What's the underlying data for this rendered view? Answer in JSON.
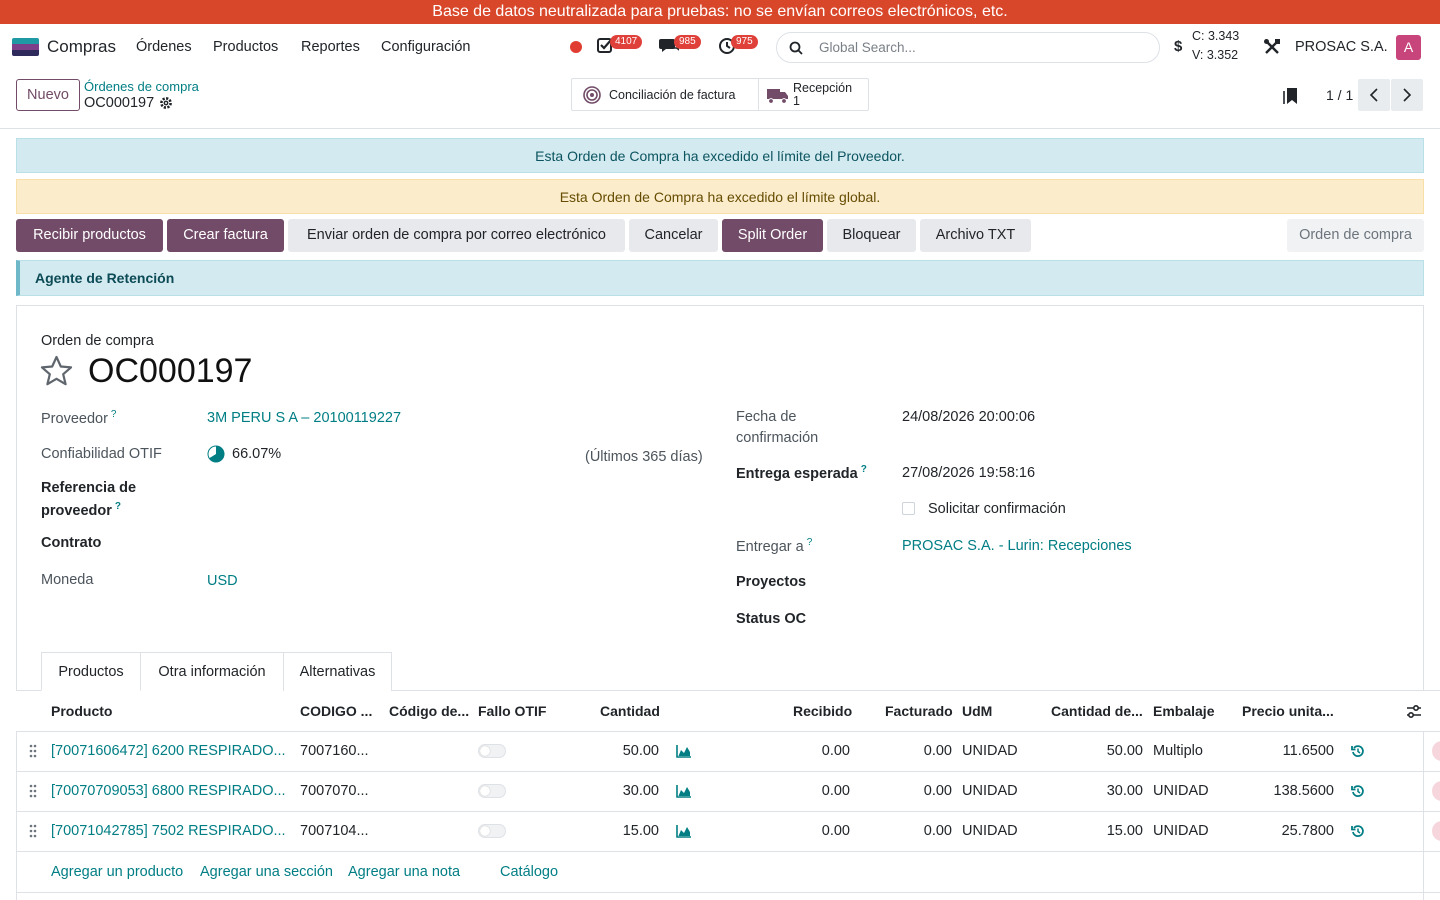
{
  "banner": {
    "text": "Base de datos neutralizada para pruebas: no se envían correos electrónicos, etc."
  },
  "navbar": {
    "app_name": "Compras",
    "menu": [
      "Órdenes",
      "Productos",
      "Reportes",
      "Configuración"
    ],
    "badges": {
      "activities": "4107",
      "messages": "985",
      "clock": "975"
    },
    "search_placeholder": "Global Search...",
    "rates": {
      "buy": "C: 3.343",
      "sell": "V: 3.352"
    },
    "company": "PROSAC S.A.",
    "avatar_letter": "A",
    "icons": [
      "status-dot-icon",
      "activity-check-icon",
      "chat-icon",
      "clock-icon",
      "search-icon",
      "dollar-icon",
      "tools-icon"
    ]
  },
  "control": {
    "new_label": "Nuevo",
    "breadcrumb_parent": "Órdenes de compra",
    "breadcrumb_current": "OC000197",
    "smart_buttons": {
      "conciliation": "Conciliación de factura",
      "reception_label": "Recepción",
      "reception_count": "1"
    },
    "pager": "1 / 1"
  },
  "alerts": {
    "vendor_limit": "Esta Orden de Compra ha excedido el límite del Proveedor.",
    "global_limit": "Esta Orden de Compra ha excedido el límite global.",
    "retention": "Agente de Retención"
  },
  "statusbar": {
    "receive": "Recibir productos",
    "invoice": "Crear factura",
    "send_email": "Enviar orden de compra por correo electrónico",
    "cancel": "Cancelar",
    "split": "Split Order",
    "lock": "Bloquear",
    "txt": "Archivo TXT",
    "state": "Orden de compra"
  },
  "form": {
    "doc_type": "Orden de compra",
    "name": "OC000197",
    "left": {
      "vendor_label": "Proveedor",
      "vendor_value": "3M PERU S A – 20100119227",
      "otif_label": "Confiabilidad OTIF",
      "otif_value": "66.07%",
      "otif_period": "(Últimos 365 días)",
      "otif_fraction": 0.6607,
      "vendor_ref_label_1": "Referencia de",
      "vendor_ref_label_2": "proveedor",
      "contract_label": "Contrato",
      "currency_label": "Moneda",
      "currency_value": "USD"
    },
    "right": {
      "confirm_label_1": "Fecha de",
      "confirm_label_2": "confirmación",
      "confirm_value": "24/08/2026 20:00:06",
      "expected_label": "Entrega esperada",
      "expected_value": "27/08/2026 19:58:16",
      "ask_confirm": "Solicitar confirmación",
      "deliver_label": "Entregar a",
      "deliver_value": "PROSAC S.A. - Lurin: Recepciones",
      "projects_label": "Proyectos",
      "status_label": "Status OC"
    },
    "help_mark": "?"
  },
  "tabs": [
    "Productos",
    "Otra información",
    "Alternativas"
  ],
  "table": {
    "headers": [
      "Producto",
      "CODIGO ...",
      "Código de...",
      "Fallo OTIF",
      "Cantidad",
      "Recibido",
      "Facturado",
      "UdM",
      "Cantidad de...",
      "Embalaje",
      "Precio unita..."
    ],
    "rows": [
      {
        "product": "[70071606472] 6200 RESPIRADO...",
        "code": "7007160...",
        "qty": "50.00",
        "received": "0.00",
        "invoiced": "0.00",
        "uom": "UNIDAD",
        "pkg_qty": "50.00",
        "packaging": "Multiplo",
        "price": "11.6500"
      },
      {
        "product": "[70070709053] 6800 RESPIRADO...",
        "code": "7007070...",
        "qty": "30.00",
        "received": "0.00",
        "invoiced": "0.00",
        "uom": "UNIDAD",
        "pkg_qty": "30.00",
        "packaging": "UNIDAD",
        "price": "138.5600"
      },
      {
        "product": "[70071042785] 7502 RESPIRADO...",
        "code": "7007104...",
        "qty": "15.00",
        "received": "0.00",
        "invoiced": "0.00",
        "uom": "UNIDAD",
        "pkg_qty": "15.00",
        "packaging": "UNIDAD",
        "price": "25.7800"
      }
    ],
    "footer": {
      "add_product": "Agregar un producto",
      "add_section": "Agregar una sección",
      "add_note": "Agregar una nota",
      "catalog": "Catálogo"
    }
  },
  "colors": {
    "primary": "#714b67",
    "link": "#017e84",
    "banner": "#d9472b",
    "badge": "#e0403a"
  }
}
